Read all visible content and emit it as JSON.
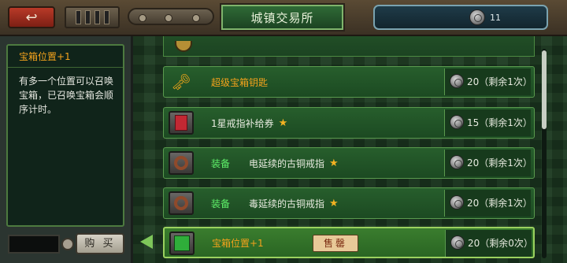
{
  "header": {
    "title": "城镇交易所",
    "currency_amount": "11"
  },
  "info": {
    "title": "宝箱位置+1",
    "description": "有多一个位置可以召唤宝箱，已召唤宝箱会顺序计时。",
    "buy_label": "购 买"
  },
  "items": [
    {
      "name": "超级宝箱钥匙",
      "prefix": "",
      "stars": "",
      "cost": "20（剩余1次）",
      "icon": "key-icon"
    },
    {
      "name": "1星戒指补给券",
      "prefix": "",
      "stars": "★",
      "cost": "15（剩余1次）",
      "icon": "ticket-icon"
    },
    {
      "name": "电延续的古铜戒指",
      "prefix": "装备",
      "stars": "★",
      "cost": "20（剩余1次）",
      "icon": "ring-icon"
    },
    {
      "name": "毒延续的古铜戒指",
      "prefix": "装备",
      "stars": "★",
      "cost": "20（剩余1次）",
      "icon": "ring-icon"
    },
    {
      "name": "宝箱位置+1",
      "prefix": "",
      "stars": "",
      "cost": "20（剩余0次）",
      "icon": "chest-slot-icon",
      "tag": "售罄"
    }
  ],
  "colors": {
    "accent_gold": "#f3a21c",
    "equip_green": "#5ff06a",
    "selected_border": "#9bd15f"
  }
}
